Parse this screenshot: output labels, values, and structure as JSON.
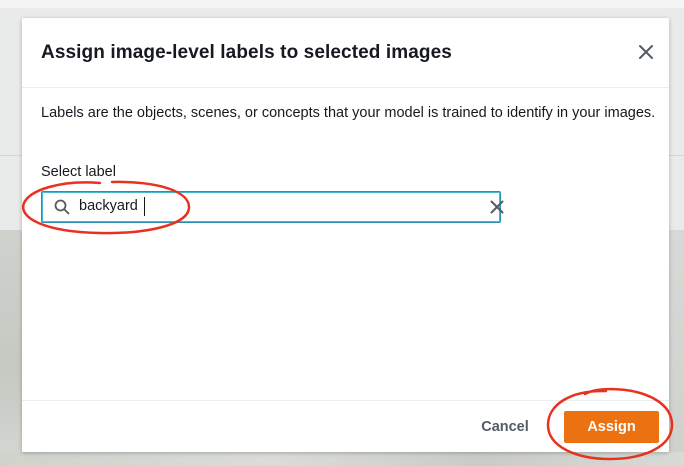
{
  "modal": {
    "title": "Assign image-level labels to selected images",
    "close_icon": "close-icon",
    "description": "Labels are the objects, scenes, or concepts that your model is trained to identify in your images.",
    "select_label": {
      "label": "Select label",
      "value": "backyard",
      "search_icon": "search-icon",
      "clear_icon": "clear-icon"
    },
    "footer": {
      "cancel_label": "Cancel",
      "assign_label": "Assign"
    }
  },
  "colors": {
    "primary_button": "#ec7211",
    "input_focus_border": "#2a8fb3",
    "annotation": "#e8311f",
    "title_text": "#16191f",
    "secondary_text": "#545b64"
  }
}
